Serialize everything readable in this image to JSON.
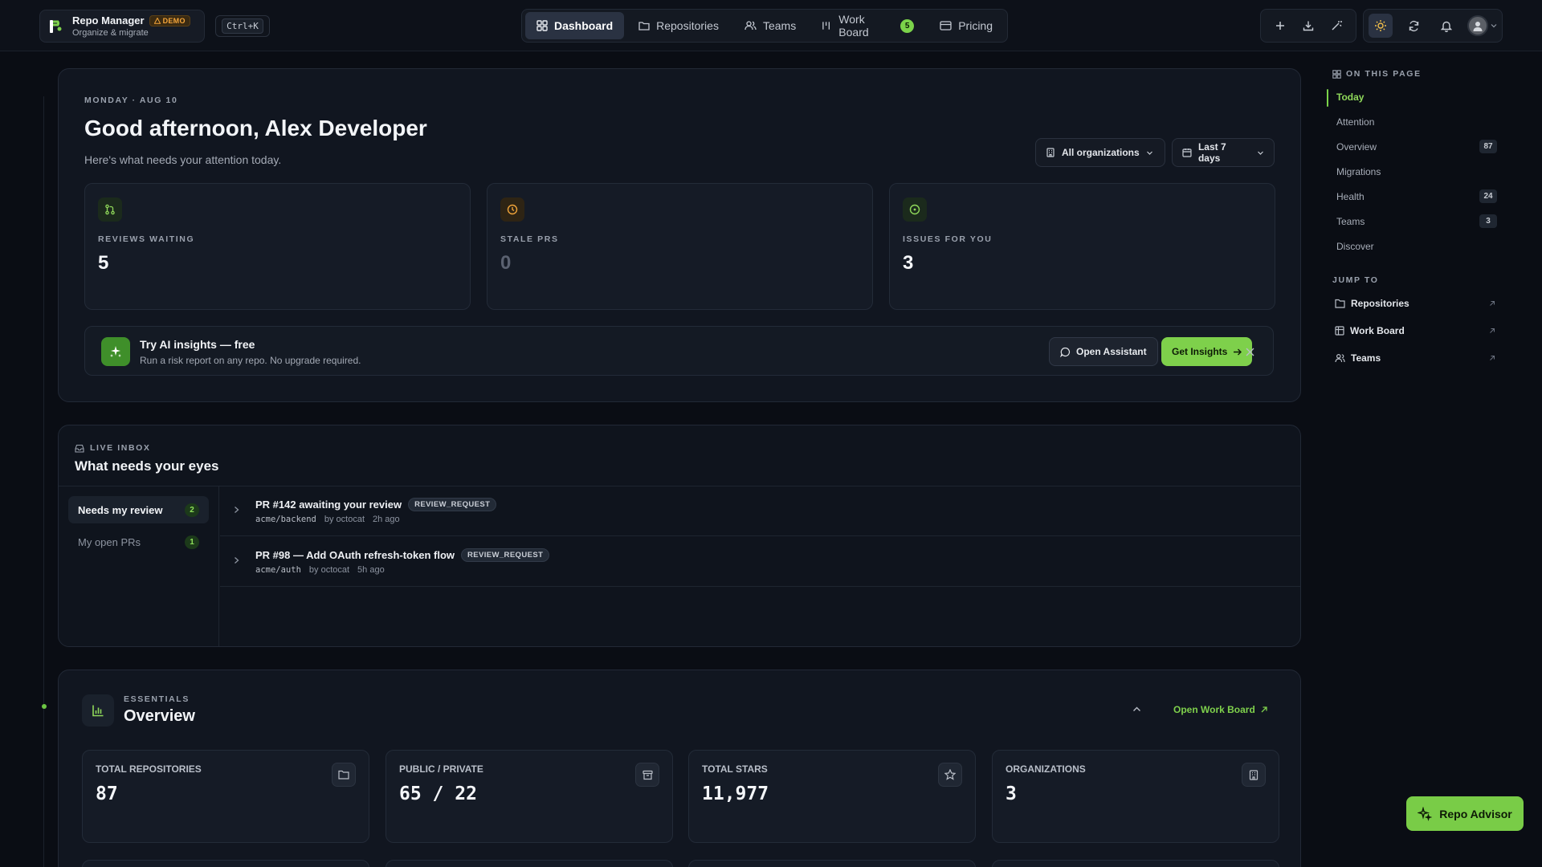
{
  "brand": {
    "title": "Repo Manager",
    "badge": "DEMO",
    "subtitle": "Organize & migrate"
  },
  "shortcut": "Ctrl+K",
  "nav": {
    "items": [
      {
        "label": "Dashboard",
        "icon": "grid-icon",
        "active": true
      },
      {
        "label": "Repositories",
        "icon": "folder-icon"
      },
      {
        "label": "Teams",
        "icon": "users-icon"
      },
      {
        "label": "Work Board",
        "icon": "columns-icon",
        "count": "5"
      },
      {
        "label": "Pricing",
        "icon": "card-icon"
      }
    ]
  },
  "hero": {
    "date": "MONDAY · AUG 10",
    "greeting": "Good afternoon, Alex Developer",
    "subtitle": "Here's what needs your attention today.",
    "filters": {
      "org": "All organizations",
      "range": "Last 7 days"
    },
    "stats": [
      {
        "label": "REVIEWS WAITING",
        "value": "5",
        "icon": "pull-request-icon",
        "color": "#8fd85a"
      },
      {
        "label": "STALE PRS",
        "value": "0",
        "icon": "clock-icon",
        "color": "#f0a43a"
      },
      {
        "label": "ISSUES FOR YOU",
        "value": "3",
        "icon": "issue-icon",
        "color": "#8fd85a"
      }
    ],
    "ai": {
      "title": "Try AI insights — free",
      "desc": "Run a risk report on any repo. No upgrade required.",
      "open_assistant": "Open Assistant",
      "get_insights": "Get Insights"
    }
  },
  "inbox": {
    "eyebrow": "LIVE INBOX",
    "title": "What needs your eyes",
    "tabs": [
      {
        "label": "Needs my review",
        "count": "2"
      },
      {
        "label": "My open PRs",
        "count": "1"
      }
    ],
    "rows": [
      {
        "title": "PR #142 awaiting your review",
        "type": "REVIEW_REQUEST",
        "repo": "acme/backend",
        "author": "by octocat",
        "time": "2h ago"
      },
      {
        "title": "PR #98 — Add OAuth refresh-token flow",
        "type": "REVIEW_REQUEST",
        "repo": "acme/auth",
        "author": "by octocat",
        "time": "5h ago"
      }
    ]
  },
  "essentials": {
    "eyebrow": "ESSENTIALS",
    "title": "Overview",
    "open_work_board": "Open Work Board",
    "kpis": [
      {
        "label": "TOTAL REPOSITORIES",
        "value": "87",
        "icon": "folder-icon"
      },
      {
        "label": "PUBLIC / PRIVATE",
        "value": "65 / 22",
        "icon": "archive-icon"
      },
      {
        "label": "TOTAL STARS",
        "value": "11,977",
        "icon": "star-icon"
      },
      {
        "label": "ORGANIZATIONS",
        "value": "3",
        "icon": "building-icon"
      }
    ]
  },
  "toc": {
    "heading": "ON THIS PAGE",
    "items": [
      {
        "label": "Today",
        "active": true
      },
      {
        "label": "Attention"
      },
      {
        "label": "Overview",
        "count": "87"
      },
      {
        "label": "Migrations"
      },
      {
        "label": "Health",
        "count": "24"
      },
      {
        "label": "Teams",
        "count": "3"
      },
      {
        "label": "Discover"
      }
    ],
    "jump_heading": "JUMP TO",
    "jump": [
      {
        "label": "Repositories",
        "icon": "folder-icon"
      },
      {
        "label": "Work Board",
        "icon": "board-icon"
      },
      {
        "label": "Teams",
        "icon": "users-icon"
      }
    ]
  },
  "advisor": {
    "label": "Repo Advisor"
  },
  "colors": {
    "accent": "#7ed04b",
    "bg": "#0a0d14",
    "panel": "#111620",
    "warn": "#f0a43a"
  }
}
